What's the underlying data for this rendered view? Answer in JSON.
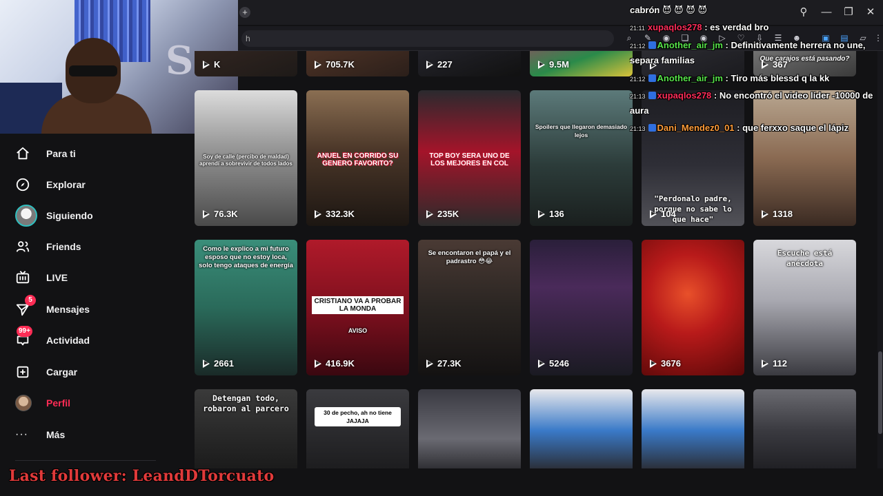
{
  "browser": {
    "new_tab": "+",
    "address_fragment": "h",
    "window_controls": [
      "search-icon",
      "minimize-icon",
      "restore-icon",
      "close-icon"
    ]
  },
  "sidebar": {
    "items": [
      {
        "label": "Para ti",
        "icon": "home-icon"
      },
      {
        "label": "Explorar",
        "icon": "compass-icon"
      },
      {
        "label": "Siguiendo",
        "icon": "following-avatar-icon"
      },
      {
        "label": "Friends",
        "icon": "friends-icon"
      },
      {
        "label": "LIVE",
        "icon": "live-tv-icon"
      },
      {
        "label": "Mensajes",
        "icon": "send-icon",
        "badge": "5"
      },
      {
        "label": "Actividad",
        "icon": "inbox-icon",
        "badge": "99+"
      },
      {
        "label": "Cargar",
        "icon": "upload-icon"
      },
      {
        "label": "Perfil",
        "icon": "profile-avatar-icon",
        "active": true
      },
      {
        "label": "Más",
        "icon": "more-icon"
      }
    ]
  },
  "overlay": {
    "last_follower": "Last follower: LeandDTorcuato",
    "accent": "#e03a3a"
  },
  "chat": {
    "header": "cabrón 😈 😈 😈 😈",
    "messages": [
      {
        "time": "21:11",
        "user": "xupaqlos278",
        "text": " : es verdad bro"
      },
      {
        "time": "21:12",
        "user": "Another_air_jm",
        "text": " : Definitivamente herrera no une,",
        "cont": "separa familias"
      },
      {
        "time": "21:12",
        "user": "Another_air_jm",
        "text": " : Tiro más blessd q la kk"
      },
      {
        "time": "21:13",
        "user": "xupaqlos278",
        "text": " : No encontró el video líder -10000 de",
        "cont": "aura"
      },
      {
        "time": "21:13",
        "user": "Dani_Mendez0_01",
        "text": " : que ferxxo saque el lápiz"
      }
    ]
  },
  "grid": {
    "row0": [
      "K",
      "705.7K",
      "227",
      "9.5M",
      "",
      "367"
    ],
    "row0_captions": [
      "",
      "",
      "",
      "",
      "",
      "Que carajos está pasando?"
    ],
    "row1": [
      {
        "views": "76.3K",
        "caption": "Soy de calle (percibo de maldad) aprendí a sobrevivir de todos lados"
      },
      {
        "views": "332.3K",
        "headline": "ANUEL EN CORRIDO SU GENERO FAVORITO?"
      },
      {
        "views": "235K",
        "headline": "TOP BOY SERA UNO DE LOS MEJORES EN COL"
      },
      {
        "views": "136",
        "caption": "Spoilers que llegaron demasiado lejos"
      },
      {
        "views": "104",
        "caption": "\"Perdonalo padre, porque no sabe lo que hace\""
      },
      {
        "views": "1318",
        "caption": ""
      }
    ],
    "row2": [
      {
        "views": "2661",
        "caption": "Como le explico a mi futuro esposo que no estoy loca, solo tengo ataques de energía"
      },
      {
        "views": "416.9K",
        "headline": "CRISTIANO VA A PROBAR LA MONDA",
        "sub": "AVISO"
      },
      {
        "views": "27.3K",
        "caption": "Se encontaron el papá y el padrastro 😳😂"
      },
      {
        "views": "5246",
        "caption": ""
      },
      {
        "views": "3676",
        "caption": ""
      },
      {
        "views": "112",
        "caption": "Escuche está anécdota"
      }
    ],
    "row3": [
      {
        "caption": "Detengan todo, robaron al parcero"
      },
      {
        "caption": "30 de pecho, ah no tiene JAJAJA"
      },
      {
        "caption": ""
      },
      {
        "caption": ""
      },
      {
        "caption": ""
      },
      {
        "caption": ""
      }
    ]
  }
}
